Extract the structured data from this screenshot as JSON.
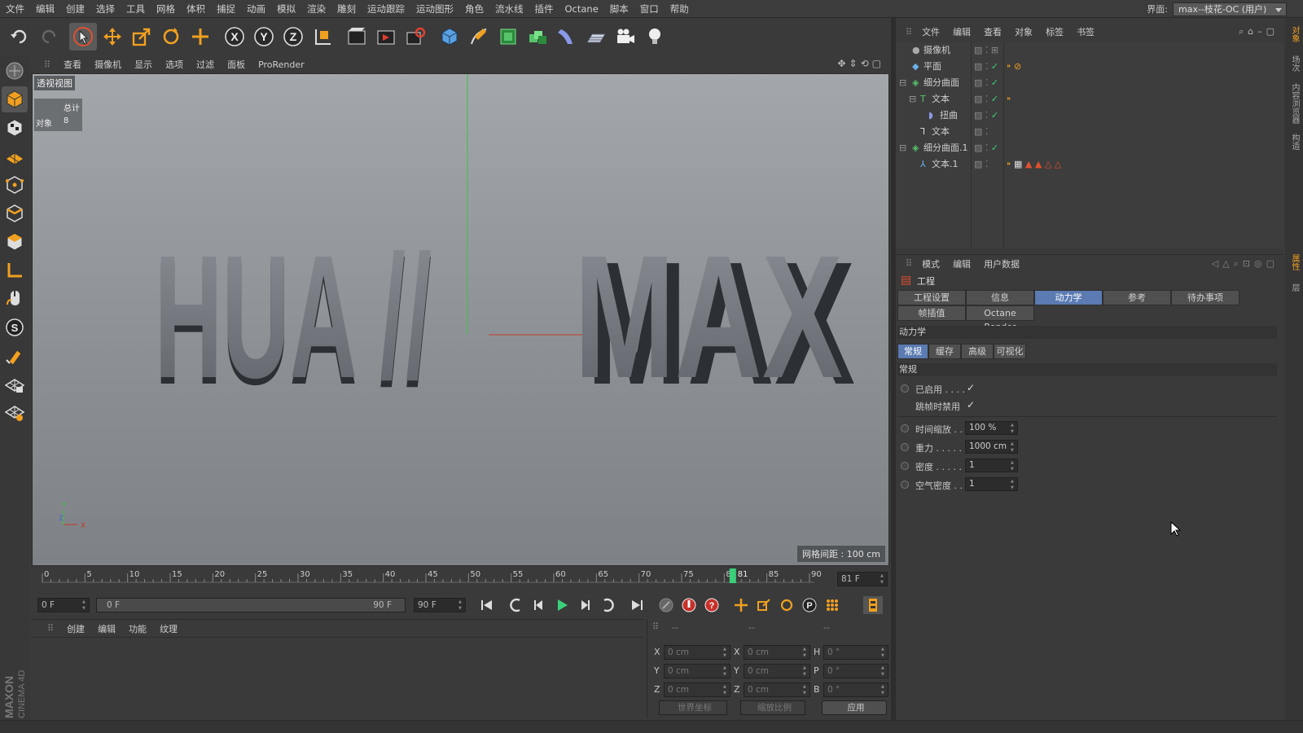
{
  "menubar": {
    "items": [
      "文件",
      "编辑",
      "创建",
      "选择",
      "工具",
      "网格",
      "体积",
      "捕捉",
      "动画",
      "模拟",
      "渲染",
      "雕刻",
      "运动跟踪",
      "运动图形",
      "角色",
      "流水线",
      "插件",
      "Octane",
      "脚本",
      "窗口",
      "帮助"
    ],
    "layout_label": "界面:",
    "layout_value": "max--枝花-OC (用户)"
  },
  "toolbar": {
    "icons": [
      "undo-icon",
      "redo-icon",
      "select-arrow-icon",
      "move-icon",
      "scale-icon",
      "rotate-icon",
      "move-add-icon",
      "x-axis-icon",
      "y-axis-icon",
      "z-axis-icon",
      "world-coord-icon",
      "render-region-icon",
      "render-view-icon",
      "render-settings-icon",
      "cube-primitive-icon",
      "pen-spline-icon",
      "subdivision-icon",
      "cloner-icon",
      "deformer-icon",
      "floor-icon",
      "camera-icon",
      "light-bulb-icon"
    ]
  },
  "leftbar": {
    "icons": [
      "model-mode-icon",
      "object-mode-icon",
      "texture-mode-icon",
      "workplane-icon",
      "points-mode-icon",
      "edges-mode-icon",
      "polygons-mode-icon",
      "axis-mode-icon",
      "tweak-mode-icon",
      "solo-icon",
      "snap-magnet-icon",
      "workplane-lock-icon",
      "grid-snap-icon"
    ],
    "logo_line1": "MAXON",
    "logo_line2": "CINEMA 4D"
  },
  "viewport": {
    "menu": [
      "查看",
      "摄像机",
      "显示",
      "选项",
      "过滤",
      "面板",
      "ProRender"
    ],
    "label": "透视视图",
    "stats_header": "总计",
    "stats_label": "对象",
    "stats_value": "8",
    "text_left": "HUA //",
    "text_right": "MAX",
    "grid_info": "网格间距 : 100 cm",
    "axis_y": "Y",
    "axis_z": "Z",
    "axis_x": "X"
  },
  "timeline": {
    "ticks": [
      "0",
      "5",
      "10",
      "15",
      "20",
      "25",
      "30",
      "35",
      "40",
      "45",
      "50",
      "55",
      "60",
      "65",
      "70",
      "75",
      "80",
      "85",
      "90"
    ],
    "current_frame_marker": "81",
    "current_frame_field": "81 F",
    "start_field": "0 F",
    "range_start": "0 F",
    "range_end": "90 F",
    "end_field": "90 F"
  },
  "materials": {
    "menu": [
      "创建",
      "编辑",
      "功能",
      "纹理"
    ]
  },
  "coords": {
    "header": [
      "--",
      "--",
      "--"
    ],
    "rows": [
      {
        "a": "X",
        "av": "0 cm",
        "b": "X",
        "bv": "0 cm",
        "c": "H",
        "cv": "0 °"
      },
      {
        "a": "Y",
        "av": "0 cm",
        "b": "Y",
        "bv": "0 cm",
        "c": "P",
        "cv": "0 °"
      },
      {
        "a": "Z",
        "av": "0 cm",
        "b": "Z",
        "bv": "0 cm",
        "c": "B",
        "cv": "0 °"
      }
    ],
    "world_label": "世界坐标",
    "scale_label": "缩放比例",
    "apply_label": "应用"
  },
  "object_manager": {
    "menu": [
      "文件",
      "编辑",
      "查看",
      "对象",
      "标签",
      "书签"
    ],
    "objects": [
      {
        "name": "摄像机",
        "indent": 0
      },
      {
        "name": "平面",
        "indent": 0
      },
      {
        "name": "细分曲面",
        "indent": 0
      },
      {
        "name": "文本",
        "indent": 1
      },
      {
        "name": "扭曲",
        "indent": 2
      },
      {
        "name": "文本",
        "indent": 1
      },
      {
        "name": "细分曲面.1",
        "indent": 0
      },
      {
        "name": "文本.1",
        "indent": 1
      }
    ]
  },
  "attributes": {
    "menu": [
      "模式",
      "编辑",
      "用户数据"
    ],
    "title": "工程",
    "tabs_row1": [
      "工程设置",
      "信息",
      "动力学",
      "参考",
      "待办事项"
    ],
    "tabs_row2": [
      "帧插值",
      "Octane Render"
    ],
    "active_tab": "动力学",
    "section": "动力学",
    "subtabs": [
      "常规",
      "缓存",
      "高级",
      "可视化"
    ],
    "active_subtab": "常规",
    "group": "常规",
    "enabled_label": "已启用 . . . .",
    "disable_on_jump_label": "跳帧时禁用",
    "props": [
      {
        "label": "时间缩放 . .",
        "value": "100 %"
      },
      {
        "label": "重力 . . . . . .",
        "value": "1000 cm"
      },
      {
        "label": "密度 . . . . . .",
        "value": "1"
      },
      {
        "label": "空气密度 . .",
        "value": "1"
      }
    ]
  },
  "right_strip": {
    "tabs": [
      "对象",
      "场次",
      "内容浏览器",
      "构造",
      "属性",
      "层"
    ]
  },
  "colors": {
    "accent_blue": "#5b7bb2",
    "bg": "#3a3a3a",
    "playhead": "#3ad07a"
  }
}
